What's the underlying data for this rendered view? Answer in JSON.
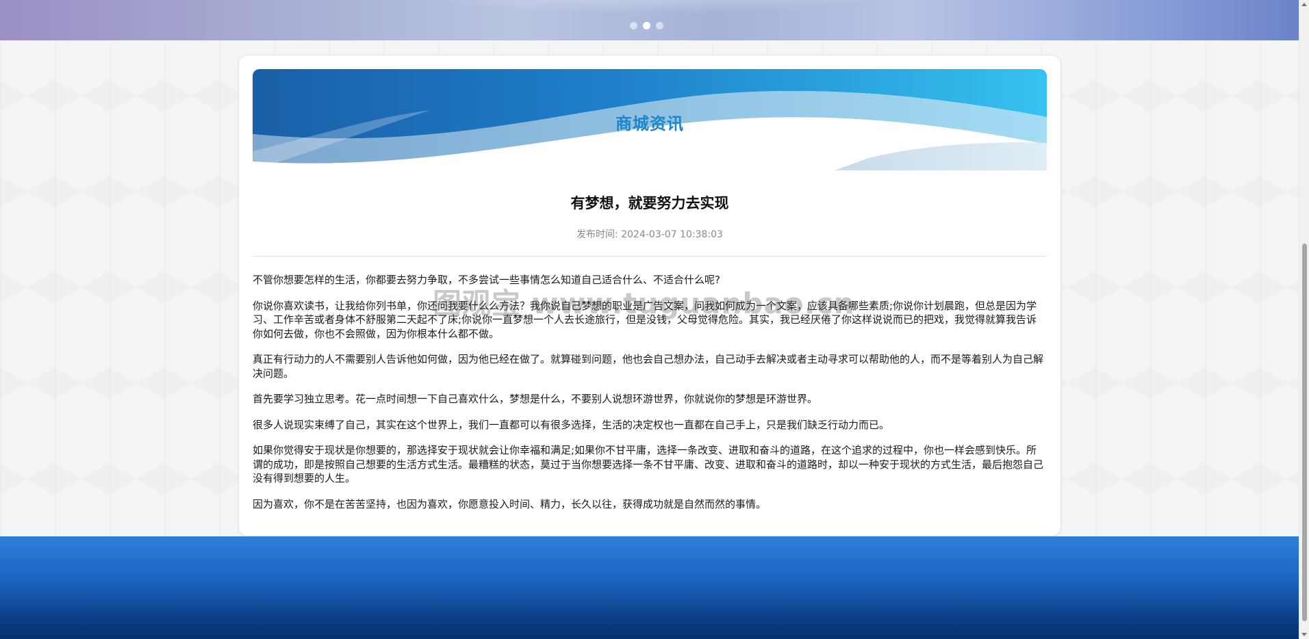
{
  "banner": {
    "dots": [
      {
        "active": false
      },
      {
        "active": true
      },
      {
        "active": false
      }
    ]
  },
  "news": {
    "section_title": "商城资讯",
    "article_title": "有梦想，就要努力去实现",
    "publish_label": "发布时间:",
    "publish_time": "2024-03-07 10:38:03",
    "paragraphs": [
      "不管你想要怎样的生活，你都要去努力争取，不多尝试一些事情怎么知道自己适合什么、不适合什么呢?",
      "你说你喜欢读书，让我给你列书单，你还问我要什么么方法？我你说自己梦想的职业是广告文案，问我如何成为一个文案，应该具备哪些素质;你说你计划晨跑，但总是因为学习、工作辛苦或者身体不舒服第二天起不了床;你说你一直梦想一个人去长途旅行，但是没钱，父母觉得危险。其实，我已经厌倦了你这样说说而已的把戏，我觉得就算我告诉你如何去做，你也不会照做，因为你根本什么都不做。",
      "真正有行动力的人不需要别人告诉他如何做，因为他已经在做了。就算碰到问题，他也会自己想办法，自己动手去解决或者主动寻求可以帮助他的人，而不是等着别人为自己解决问题。",
      "首先要学习独立思考。花一点时间想一下自己喜欢什么，梦想是什么，不要别人说想环游世界，你就说你的梦想是环游世界。",
      "很多人说现实束缚了自己，其实在这个世界上，我们一直都可以有很多选择，生活的决定权也一直都在自己手上，只是我们缺乏行动力而已。",
      "如果你觉得安于现状是你想要的，那选择安于现状就会让你幸福和满足;如果你不甘平庸，选择一条改变、进取和奋斗的道路，在这个追求的过程中，你也一样会感到快乐。所谓的成功，即是按照自己想要的生活方式生活。最糟糕的状态，莫过于当你想要选择一条不甘平庸、改变、进取和奋斗的道路时，却以一种安于现状的方式生活，最后抱怨自己没有得到想要的人生。",
      "因为喜欢，你不是在苦苦坚持，也因为喜欢，你愿意投入时间、精力，长久以往，获得成功就是自然而然的事情。"
    ]
  },
  "watermark": "图观宝 www.tuguanbao.cn",
  "colors": {
    "section_title": "#1f86c9",
    "footer_top": "#2b7fd8",
    "footer_bottom": "#05306d"
  }
}
